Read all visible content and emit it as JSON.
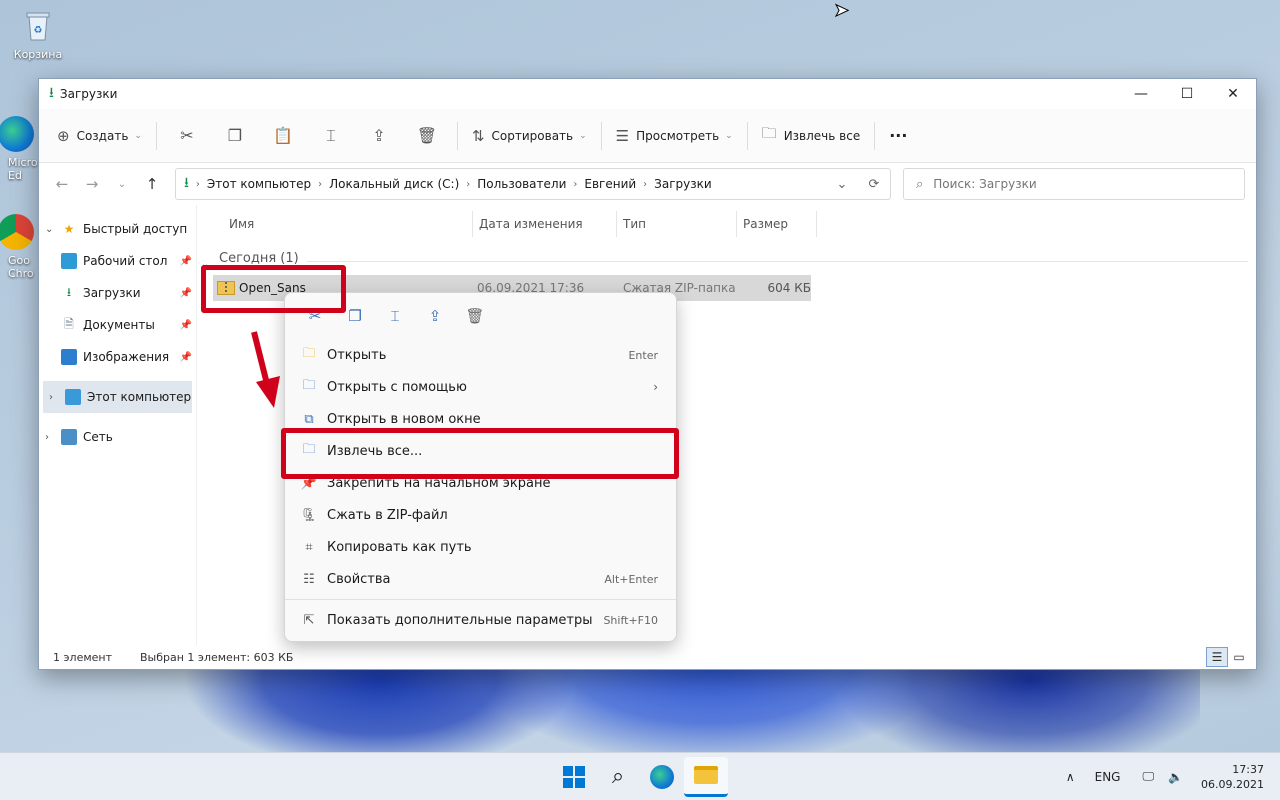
{
  "desktop": {
    "icons": [
      {
        "label": "Корзина"
      },
      {
        "label": "Micro Ed"
      },
      {
        "label": "Goo Chro"
      }
    ]
  },
  "window": {
    "title": "Загрузки",
    "controls": {
      "minimize": "—",
      "maximize": "☐",
      "close": "✕"
    }
  },
  "toolbar": {
    "create": "Создать",
    "sort": "Сортировать",
    "view": "Просмотреть",
    "extract_all": "Извлечь все",
    "more": "···"
  },
  "address": {
    "crumbs": [
      "Этот компьютер",
      "Локальный диск (C:)",
      "Пользователи",
      "Евгений",
      "Загрузки"
    ],
    "search_placeholder": "Поиск: Загрузки"
  },
  "sidebar": {
    "quick_access": "Быстрый доступ",
    "items": [
      {
        "label": "Рабочий стол"
      },
      {
        "label": "Загрузки"
      },
      {
        "label": "Документы"
      },
      {
        "label": "Изображения"
      }
    ],
    "this_pc": "Этот компьютер",
    "network": "Сеть"
  },
  "columns": [
    "Имя",
    "Дата изменения",
    "Тип",
    "Размер"
  ],
  "group": {
    "title": "Сегодня (1)"
  },
  "file": {
    "name": "Open_Sans",
    "date": "06.09.2021 17:36",
    "type": "Сжатая ZIP-папка",
    "size": "604 КБ"
  },
  "status": {
    "count": "1 элемент",
    "selected": "Выбран 1 элемент: 603 КБ"
  },
  "context_menu": {
    "items": [
      {
        "label": "Открыть",
        "shortcut": "Enter"
      },
      {
        "label": "Открыть с помощью",
        "shortcut": ""
      },
      {
        "label": "Открыть в новом окне",
        "shortcut": ""
      },
      {
        "label": "Извлечь все...",
        "shortcut": ""
      },
      {
        "label": "Закрепить на начальном экране",
        "shortcut": ""
      },
      {
        "label": "Сжать в ZIP-файл",
        "shortcut": ""
      },
      {
        "label": "Копировать как путь",
        "shortcut": ""
      },
      {
        "label": "Свойства",
        "shortcut": "Alt+Enter"
      }
    ],
    "more_options": {
      "label": "Показать дополнительные параметры",
      "shortcut": "Shift+F10"
    }
  },
  "taskbar": {
    "language": "ENG",
    "time": "17:37",
    "date": "06.09.2021"
  },
  "colors": {
    "annotation_red": "#d0021b",
    "accent_blue": "#0067c0"
  }
}
